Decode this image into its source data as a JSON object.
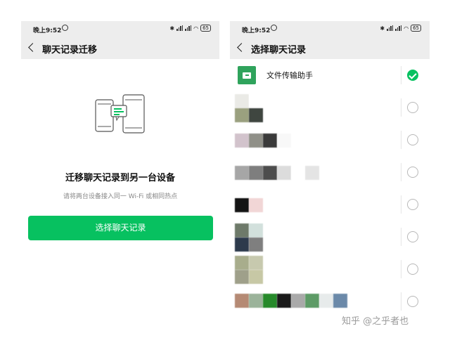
{
  "left": {
    "status": {
      "time": "晚上9:52",
      "battery": "65"
    },
    "title": "聊天记录迁移",
    "heading": "迁移聊天记录到另一台设备",
    "subtext": "请将两台设备接入同一 Wi-Fi 或相同热点",
    "button_label": "选择聊天记录"
  },
  "right": {
    "status": {
      "time": "晚上9:52",
      "battery": "65"
    },
    "title": "选择聊天记录",
    "rows": [
      {
        "name": "文件传输助手",
        "checked": true
      },
      {
        "name": "",
        "checked": false
      },
      {
        "name": "",
        "checked": false
      },
      {
        "name": "",
        "checked": false
      },
      {
        "name": "",
        "checked": false
      },
      {
        "name": "",
        "checked": false
      },
      {
        "name": "",
        "checked": false
      },
      {
        "name": "",
        "checked": false
      }
    ]
  },
  "watermark": "知乎 @之乎者也",
  "colors": {
    "accent": "#07c160",
    "bar_bg": "#ededed"
  }
}
